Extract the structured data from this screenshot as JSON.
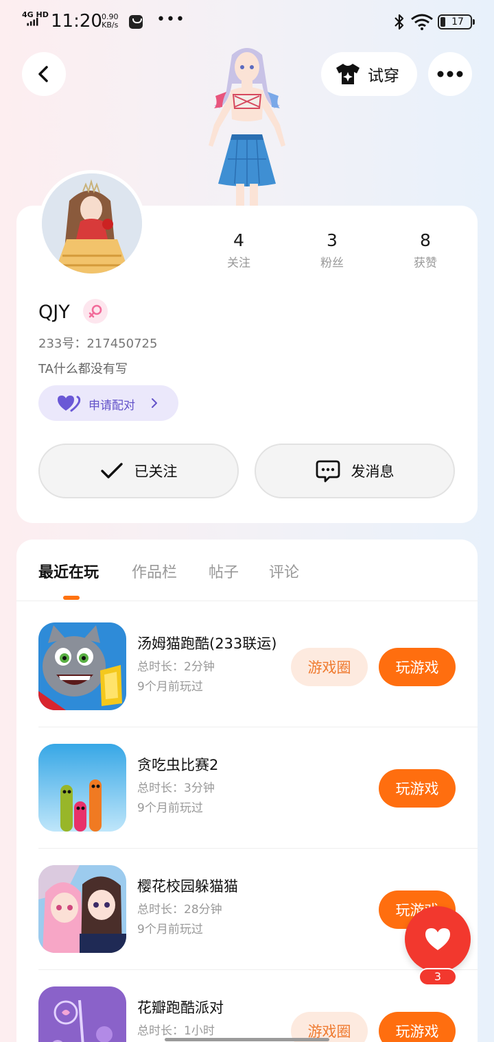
{
  "status_bar": {
    "network": "4G HD",
    "time": "11:20",
    "speed_value": "0.90",
    "speed_unit": "KB/s",
    "more": "•••",
    "battery": "17",
    "battery_level_percent": 17
  },
  "header": {
    "try_on_label": "试穿"
  },
  "profile": {
    "name": "QJY",
    "gender": "female",
    "uid": "233号：217450725",
    "bio": "TA什么都没有写",
    "stats": [
      {
        "value": "4",
        "label": "关注"
      },
      {
        "value": "3",
        "label": "粉丝"
      },
      {
        "value": "8",
        "label": "获赞"
      }
    ],
    "pair_label": "申请配对",
    "follow_label": "已关注",
    "message_label": "发消息"
  },
  "tabs": [
    {
      "label": "最近在玩",
      "active": true
    },
    {
      "label": "作品栏",
      "active": false
    },
    {
      "label": "帖子",
      "active": false
    },
    {
      "label": "评论",
      "active": false
    }
  ],
  "games": [
    {
      "title": "汤姆猫跑酷(233联运)",
      "duration": "总时长：2分钟",
      "last_played": "9个月前玩过",
      "circle_label": "游戏圈",
      "play_label": "玩游戏",
      "icon": "talking-tom-icon"
    },
    {
      "title": "贪吃虫比赛2",
      "duration": "总时长：3分钟",
      "last_played": "9个月前玩过",
      "play_label": "玩游戏",
      "icon": "worms-icon"
    },
    {
      "title": "樱花校园躲猫猫",
      "duration": "总时长：28分钟",
      "last_played": "9个月前玩过",
      "play_label": "玩游戏",
      "icon": "anime-girls-icon"
    },
    {
      "title": "花瓣跑酷派对",
      "duration": "总时长：1小时",
      "last_played": "",
      "circle_label": "游戏圈",
      "play_label": "玩游戏",
      "icon": "petal-icon"
    }
  ],
  "like_fab": {
    "count": "3"
  },
  "colors": {
    "accent_orange": "#ff6e0f",
    "pair_purple": "#6353c9",
    "like_red": "#f2382e"
  }
}
